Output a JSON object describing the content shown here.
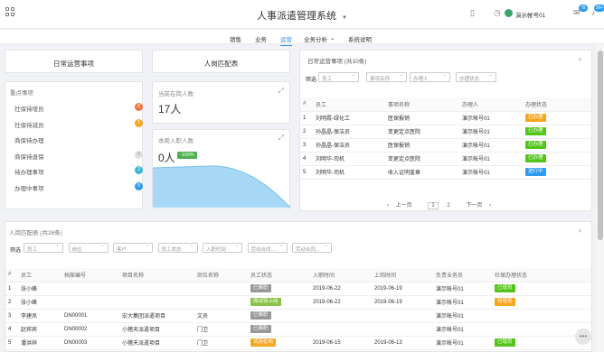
{
  "header": {
    "title": "人事派遣管理系统",
    "user": "演示帐号01",
    "badge_msg": "78",
    "badge_notice": "99+"
  },
  "nav": [
    "销售",
    "业务",
    "运营",
    "业务分析",
    "系统说明"
  ],
  "left_card_title": "日常运营事项",
  "key_items": {
    "title": "重点事项",
    "rows": [
      {
        "label": "社保待增员",
        "count": "8",
        "color": "#f0743c"
      },
      {
        "label": "社保待减员",
        "count": "1",
        "color": "#f6a623"
      },
      {
        "label": "商保待办理",
        "count": "",
        "color": ""
      },
      {
        "label": "商保待退保",
        "count": "0",
        "color": "#e0e0e0"
      },
      {
        "label": "待办理事项",
        "count": "2",
        "color": "#36b8d6"
      },
      {
        "label": "办理中事项",
        "count": "5",
        "color": "#2d9bf0"
      }
    ]
  },
  "match_card_title": "人岗匹配表",
  "current": {
    "label": "当前在岗人数",
    "value": "17人"
  },
  "weekly": {
    "label": "本周入职人数",
    "value": "0人",
    "pct": "-100%"
  },
  "daily": {
    "title": "日常运营事项 (共10条)",
    "filter_label": "筛选",
    "filters": [
      "员工",
      "事项名称",
      "办理人",
      "办理状态"
    ],
    "columns": [
      "#",
      "员工",
      "事项名称",
      "办理人",
      "办理状态"
    ],
    "rows": [
      {
        "n": "1",
        "emp": "刘明霞-绿化工",
        "item": "医保报销",
        "agent": "演示帐号01",
        "status": "已办理",
        "color": "#f6a623"
      },
      {
        "n": "2",
        "emp": "孙晶晶-保洁员",
        "item": "变更定点医院",
        "agent": "演示帐号01",
        "status": "已办理",
        "color": "#52c41a"
      },
      {
        "n": "3",
        "emp": "孙晶晶-保洁员",
        "item": "医保报销",
        "agent": "演示帐号01",
        "status": "已办理",
        "color": "#52c41a"
      },
      {
        "n": "4",
        "emp": "刘明华-司机",
        "item": "变更定点医院",
        "agent": "演示帐号01",
        "status": "已办理",
        "color": "#52c41a"
      },
      {
        "n": "5",
        "emp": "刘明华-司机",
        "item": "收入证明盖章",
        "agent": "演示帐号01",
        "status": "进行中",
        "color": "#2d9bf0"
      }
    ],
    "pager": {
      "prev": "上一页",
      "p1": "1",
      "p2": "2",
      "next": "下一页"
    }
  },
  "match": {
    "title": "人岗匹配表 (共26条)",
    "filter_label": "筛选",
    "filters": [
      "员工",
      "岗位",
      "客户",
      "员工状态",
      "入职时间",
      "劳动合同...",
      "劳动合同..."
    ],
    "columns": [
      "#",
      "员工",
      "档案编号",
      "项目名称",
      "岗位名称",
      "员工状态",
      "入职时间",
      "上岗时间",
      "负责业务员",
      "社保办理状态"
    ],
    "rows": [
      {
        "n": "1",
        "emp": "张小峰",
        "no": "",
        "proj": "",
        "pos": "",
        "st": "已离职",
        "stc": "#999",
        "in": "2019-06-22",
        "up": "2019-06-19",
        "agent": "演示帐号01",
        "ss": "已增员",
        "ssc": "#52c41a"
      },
      {
        "n": "2",
        "emp": "张小峰",
        "no": "",
        "proj": "",
        "pos": "",
        "st": "面试待上岗",
        "stc": "#8bc34a",
        "in": "2019-06-22",
        "up": "2019-06-19",
        "agent": "演示帐号01",
        "ss": "待增员",
        "ssc": "#f6a623"
      },
      {
        "n": "3",
        "emp": "李建凤",
        "no": "DN00001",
        "proj": "宏大集团派遣项目",
        "pos": "文员",
        "st": "已离职",
        "stc": "#999",
        "in": "",
        "up": "",
        "agent": "演示帐号01",
        "ss": "",
        "ssc": ""
      },
      {
        "n": "4",
        "emp": "赵宾宾",
        "no": "DN00002",
        "proj": "小猪天派遣项目",
        "pos": "门卫",
        "st": "已离职",
        "stc": "#999",
        "in": "",
        "up": "",
        "agent": "演示帐号01",
        "ss": "",
        "ssc": ""
      },
      {
        "n": "5",
        "emp": "潘洪祥",
        "no": "DN00003",
        "proj": "小猪天派遣项目",
        "pos": "门卫",
        "st": "试用在岗",
        "stc": "#f6a623",
        "in": "2019-06-15",
        "up": "2019-06-13",
        "agent": "演示帐号01",
        "ss": "已增员",
        "ssc": "#52c41a"
      }
    ]
  }
}
